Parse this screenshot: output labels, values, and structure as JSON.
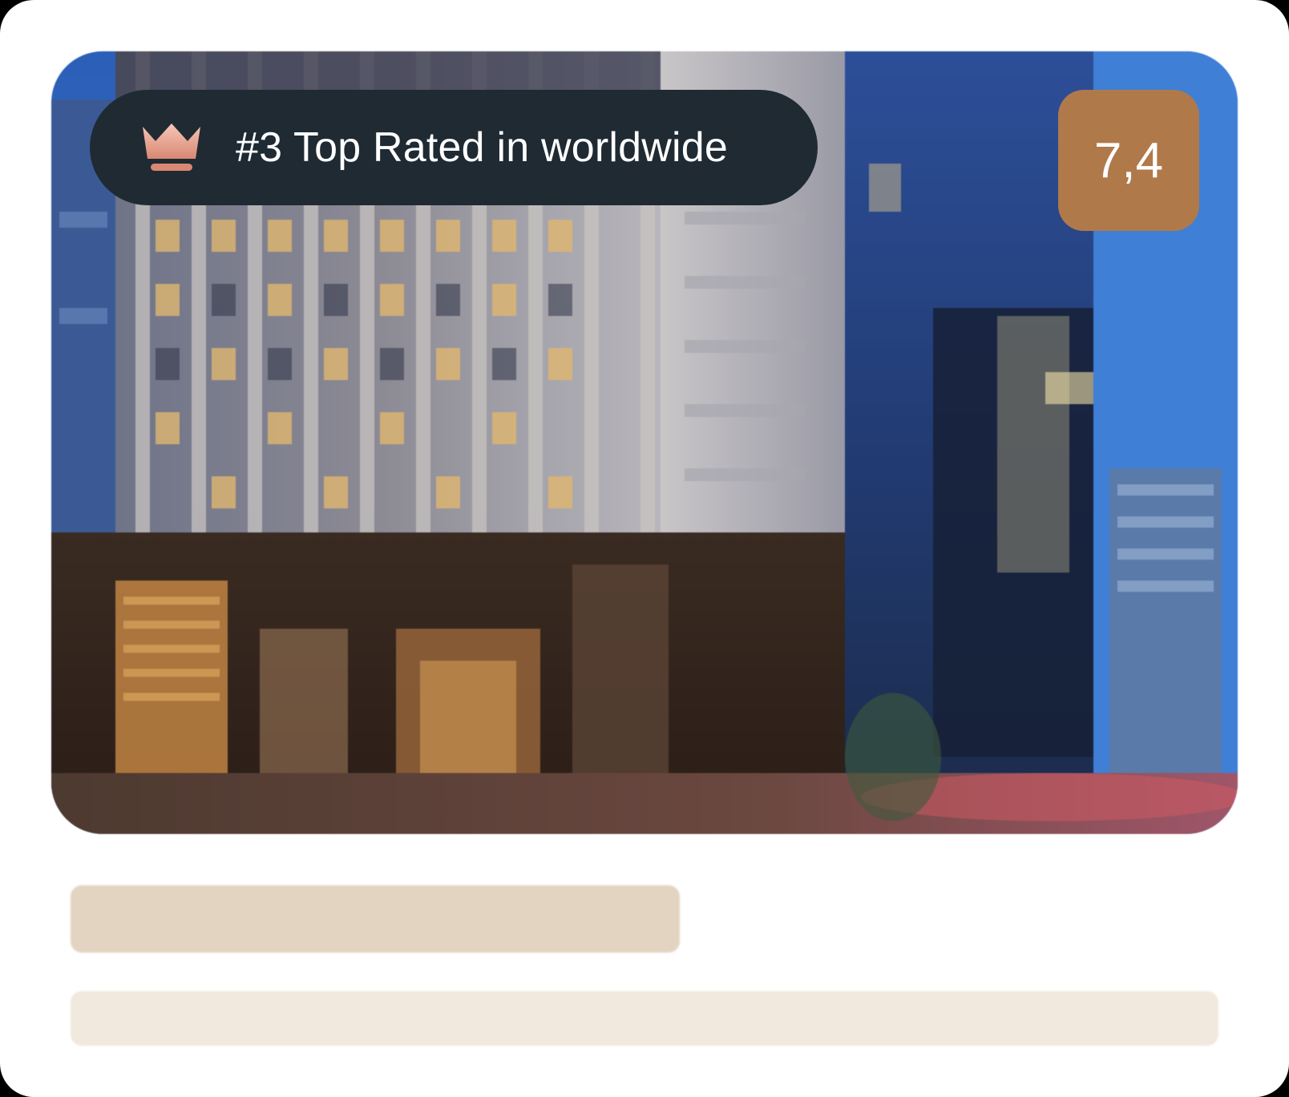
{
  "card": {
    "badge": {
      "icon": "crown-icon",
      "text": "#3 Top Rated in worldwide"
    },
    "score": {
      "value": "7,4"
    }
  },
  "colors": {
    "badge_bg": "#1f2a33",
    "score_bg": "#b0794a",
    "crown_accent": "#e2a08d",
    "skeleton_title": "#e3d3c1",
    "skeleton_line": "#f1e8de"
  }
}
